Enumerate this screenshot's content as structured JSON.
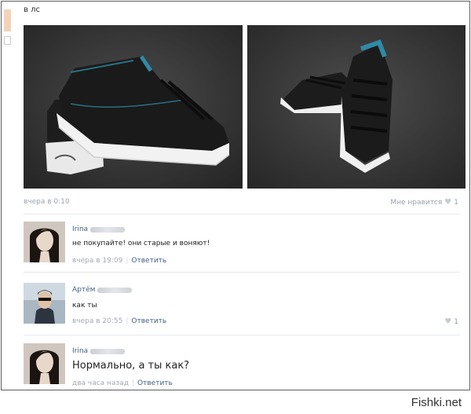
{
  "post": {
    "text": "в лс",
    "date": "вчера в 0:10",
    "like_label": "Мне нравится",
    "like_count": "1"
  },
  "comments": [
    {
      "author": "Irina",
      "text": "не покупайте! они старые и воняют!",
      "time": "вчера в 19:09",
      "reply": "Ответить"
    },
    {
      "author": "Артём",
      "text": "как ты",
      "time": "вчера в 20:55",
      "reply": "Ответить",
      "likes": "1"
    },
    {
      "author": "Irina",
      "text": "Нормально, а ты как?",
      "time": "два часа назад",
      "reply": "Ответить"
    }
  ],
  "watermark": "Fishki.net",
  "icons": {
    "like": "heart-icon"
  }
}
